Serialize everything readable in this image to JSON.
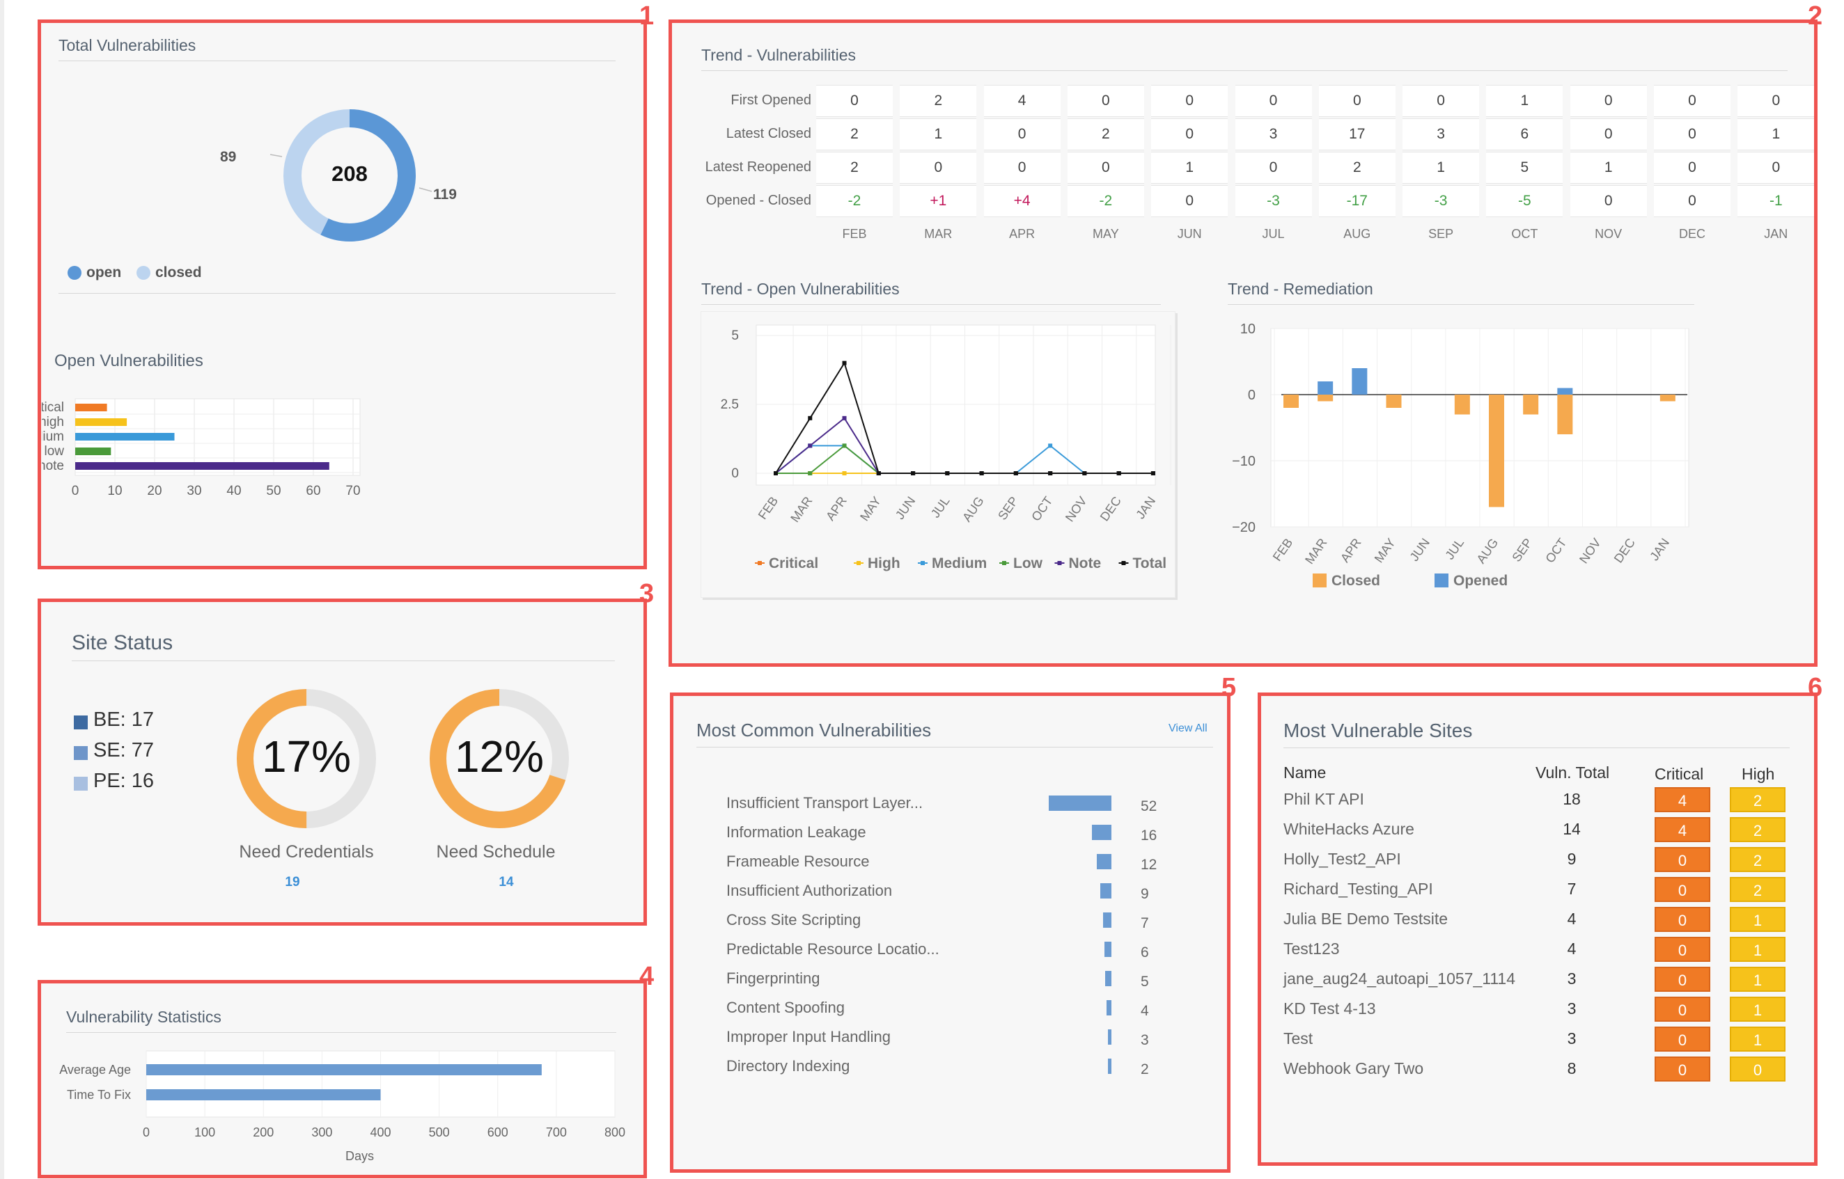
{
  "panels": {
    "total_vulnerabilities": {
      "number": "1",
      "title": "Total Vulnerabilities",
      "total": "208",
      "open_value": "119",
      "closed_value": "89",
      "legend": [
        "open",
        "closed"
      ],
      "colors": {
        "open": "#5b97d6",
        "closed": "#bcd4ef"
      },
      "open_title": "Open Vulnerabilities",
      "open_chart": {
        "categories": [
          "critical",
          "high",
          "medium",
          "low",
          "note"
        ],
        "values": [
          8,
          13,
          25,
          9,
          64
        ],
        "colors": [
          "#f07a25",
          "#f6c21b",
          "#3a9ad9",
          "#4a9a3a",
          "#4b2a8a"
        ],
        "ticks": [
          "0",
          "10",
          "20",
          "30",
          "40",
          "50",
          "60",
          "70"
        ],
        "max": 70
      }
    },
    "trend": {
      "number": "2",
      "title": "Trend - Vulnerabilities",
      "row_labels": [
        "First Opened",
        "Latest Closed",
        "Latest Reopened",
        "Opened - Closed"
      ],
      "months": [
        "FEB",
        "MAR",
        "APR",
        "MAY",
        "JUN",
        "JUL",
        "AUG",
        "SEP",
        "OCT",
        "NOV",
        "DEC",
        "JAN"
      ],
      "first_opened": [
        "0",
        "2",
        "4",
        "0",
        "0",
        "0",
        "0",
        "0",
        "1",
        "0",
        "0",
        "0"
      ],
      "latest_closed": [
        "2",
        "1",
        "0",
        "2",
        "0",
        "3",
        "17",
        "3",
        "6",
        "0",
        "0",
        "1"
      ],
      "latest_reopened": [
        "2",
        "0",
        "0",
        "0",
        "1",
        "0",
        "2",
        "1",
        "5",
        "1",
        "0",
        "0"
      ],
      "opened_closed": [
        "-2",
        "+1",
        "+4",
        "-2",
        "0",
        "-3",
        "-17",
        "-3",
        "-5",
        "0",
        "0",
        "-1"
      ],
      "opened_closed_colors": {
        "positive": "#c2185b",
        "negative": "#43a047",
        "neutral": "#444444"
      }
    },
    "trend_open": {
      "title": "Trend - Open Vulnerabilities"
    },
    "trend_remediation": {
      "title": "Trend - Remediation"
    },
    "site_status": {
      "number": "3",
      "title": "Site Status",
      "legend": [
        {
          "label": "BE: 17",
          "color": "#3d6aa1"
        },
        {
          "label": "SE: 77",
          "color": "#6e95c9"
        },
        {
          "label": "PE: 16",
          "color": "#a8bfe0"
        }
      ],
      "donuts": [
        {
          "percent": "17%",
          "fraction": 0.5,
          "label": "Need Credentials",
          "count": "19"
        },
        {
          "percent": "12%",
          "fraction": 0.7,
          "label": "Need Schedule",
          "count": "14"
        }
      ],
      "colors": {
        "fill": "#f5a94e",
        "track": "#e4e4e4"
      }
    },
    "vulnerability_statistics": {
      "number": "4",
      "title": "Vulnerability Statistics",
      "chart": {
        "categories": [
          "Average Age",
          "Time To Fix"
        ],
        "values": [
          675,
          400
        ],
        "ticks": [
          "0",
          "100",
          "200",
          "300",
          "400",
          "500",
          "600",
          "700",
          "800"
        ],
        "max": 800,
        "xlabel": "Days",
        "color": "#6b9bd1"
      }
    },
    "most_common": {
      "number": "5",
      "title": "Most Common Vulnerabilities",
      "view_all": "View All",
      "items": [
        {
          "name": "Insufficient Transport Layer...",
          "value": "52"
        },
        {
          "name": "Information Leakage",
          "value": "16"
        },
        {
          "name": "Frameable Resource",
          "value": "12"
        },
        {
          "name": "Insufficient Authorization",
          "value": "9"
        },
        {
          "name": "Cross Site Scripting",
          "value": "7"
        },
        {
          "name": "Predictable Resource Locatio...",
          "value": "6"
        },
        {
          "name": "Fingerprinting",
          "value": "5"
        },
        {
          "name": "Content Spoofing",
          "value": "4"
        },
        {
          "name": "Improper Input Handling",
          "value": "3"
        },
        {
          "name": "Directory Indexing",
          "value": "2"
        }
      ]
    },
    "most_vulnerable_sites": {
      "number": "6",
      "title": "Most Vulnerable Sites",
      "headers": {
        "name": "Name",
        "total": "Vuln. Total",
        "critical": "Critical",
        "high": "High"
      },
      "rows": [
        {
          "name": "Phil KT API",
          "total": "18",
          "critical": "4",
          "high": "2"
        },
        {
          "name": "WhiteHacks Azure",
          "total": "14",
          "critical": "4",
          "high": "2"
        },
        {
          "name": "Holly_Test2_API",
          "total": "9",
          "critical": "0",
          "high": "2"
        },
        {
          "name": "Richard_Testing_API",
          "total": "7",
          "critical": "0",
          "high": "2"
        },
        {
          "name": "Julia BE Demo Testsite",
          "total": "4",
          "critical": "0",
          "high": "1"
        },
        {
          "name": "Test123",
          "total": "4",
          "critical": "0",
          "high": "1"
        },
        {
          "name": "jane_aug24_autoapi_1057_1114",
          "total": "3",
          "critical": "0",
          "high": "1"
        },
        {
          "name": "KD Test 4-13",
          "total": "3",
          "critical": "0",
          "high": "1"
        },
        {
          "name": "Test",
          "total": "3",
          "critical": "0",
          "high": "1"
        },
        {
          "name": "Webhook Gary Two",
          "total": "8",
          "critical": "0",
          "high": "0"
        }
      ]
    }
  },
  "chart_data": [
    {
      "type": "pie",
      "title": "Total Vulnerabilities",
      "categories": [
        "open",
        "closed"
      ],
      "values": [
        119,
        89
      ],
      "center_label": "208"
    },
    {
      "type": "bar",
      "title": "Open Vulnerabilities",
      "orientation": "horizontal",
      "categories": [
        "critical",
        "high",
        "medium",
        "low",
        "note"
      ],
      "values": [
        8,
        13,
        25,
        9,
        64
      ],
      "xlim": [
        0,
        70
      ]
    },
    {
      "type": "line",
      "title": "Trend - Open Vulnerabilities",
      "x": [
        "FEB",
        "MAR",
        "APR",
        "MAY",
        "JUN",
        "JUL",
        "AUG",
        "SEP",
        "OCT",
        "NOV",
        "DEC",
        "JAN"
      ],
      "ylim": [
        0,
        5
      ],
      "y_ticks": [
        "0",
        "2.5",
        "5"
      ],
      "legend": "bottom",
      "series": [
        {
          "name": "Critical",
          "color": "#f07a25",
          "values": [
            0,
            0,
            0,
            0,
            0,
            0,
            0,
            0,
            0,
            0,
            0,
            0
          ]
        },
        {
          "name": "High",
          "color": "#f6c21b",
          "values": [
            0,
            0,
            0,
            0,
            0,
            0,
            0,
            0,
            0,
            0,
            0,
            0
          ]
        },
        {
          "name": "Medium",
          "color": "#3a9ad9",
          "values": [
            0,
            1,
            1,
            0,
            0,
            0,
            0,
            0,
            1,
            0,
            0,
            0
          ]
        },
        {
          "name": "Low",
          "color": "#4a9a3a",
          "values": [
            0,
            0,
            1,
            0,
            0,
            0,
            0,
            0,
            0,
            0,
            0,
            0
          ]
        },
        {
          "name": "Note",
          "color": "#4b2a8a",
          "values": [
            0,
            1,
            2,
            0,
            0,
            0,
            0,
            0,
            0,
            0,
            0,
            0
          ]
        },
        {
          "name": "Total",
          "color": "#111111",
          "values": [
            0,
            2,
            4,
            0,
            0,
            0,
            0,
            0,
            0,
            0,
            0,
            0
          ]
        }
      ]
    },
    {
      "type": "bar",
      "title": "Trend - Remediation",
      "x": [
        "FEB",
        "MAR",
        "APR",
        "MAY",
        "JUN",
        "JUL",
        "AUG",
        "SEP",
        "OCT",
        "NOV",
        "DEC",
        "JAN"
      ],
      "ylim": [
        -20,
        10
      ],
      "y_ticks": [
        "10",
        "0",
        "−10",
        "−20"
      ],
      "legend": "bottom",
      "series": [
        {
          "name": "Closed",
          "color": "#f5a94e",
          "values": [
            -2,
            -1,
            0,
            -2,
            0,
            -3,
            -17,
            -3,
            -6,
            0,
            0,
            -1
          ]
        },
        {
          "name": "Opened",
          "color": "#5b97d6",
          "values": [
            0,
            2,
            4,
            0,
            0,
            0,
            0,
            0,
            1,
            0,
            0,
            0
          ]
        }
      ]
    },
    {
      "type": "bar",
      "title": "Vulnerability Statistics",
      "orientation": "horizontal",
      "categories": [
        "Average Age",
        "Time To Fix"
      ],
      "values": [
        675,
        400
      ],
      "xlabel": "Days",
      "xlim": [
        0,
        800
      ]
    },
    {
      "type": "bar",
      "title": "Most Common Vulnerabilities",
      "orientation": "horizontal",
      "categories": [
        "Insufficient Transport Layer...",
        "Information Leakage",
        "Frameable Resource",
        "Insufficient Authorization",
        "Cross Site Scripting",
        "Predictable Resource Locatio...",
        "Fingerprinting",
        "Content Spoofing",
        "Improper Input Handling",
        "Directory Indexing"
      ],
      "values": [
        52,
        16,
        12,
        9,
        7,
        6,
        5,
        4,
        3,
        2
      ]
    }
  ]
}
